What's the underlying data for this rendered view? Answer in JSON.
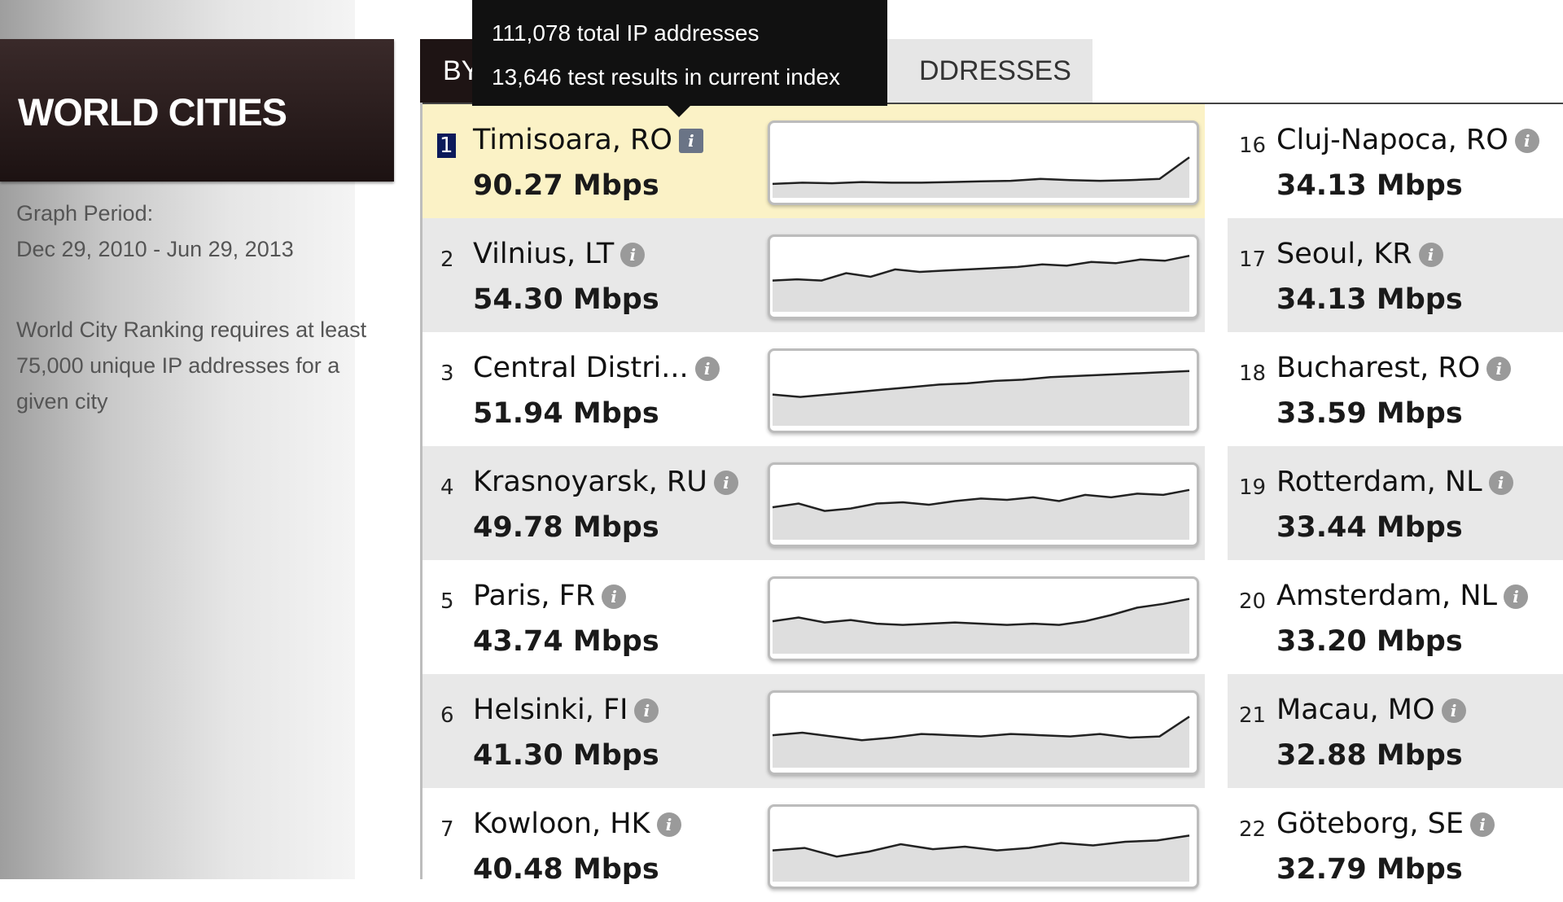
{
  "sidebar": {
    "title": "WORLD CITIES",
    "graph_period_label": "Graph Period:",
    "graph_period_range": "Dec 29, 2010 - Jun 29, 2013",
    "ranking_note": "World City Ranking requires at least 75,000 unique IP addresses for a given city"
  },
  "tabs": {
    "speed_label": "BY",
    "ip_label": "DDRESSES"
  },
  "tooltip": {
    "line1": "111,078 total IP addresses",
    "line2": "13,646 test results in current index"
  },
  "icons": {
    "info": "info-icon"
  },
  "colors": {
    "title_bg": "#1e1414",
    "selected_bg": "#fbf2c6",
    "highlight": "#0c1a5a"
  },
  "left_rankings": [
    {
      "rank": "1",
      "city": "Timisoara, RO",
      "speed": "90.27 Mbps",
      "trend": [
        0.12,
        0.14,
        0.13,
        0.15,
        0.14,
        0.14,
        0.15,
        0.16,
        0.17,
        0.2,
        0.18,
        0.17,
        0.18,
        0.2,
        0.55
      ]
    },
    {
      "rank": "2",
      "city": "Vilnius, LT",
      "speed": "54.30 Mbps",
      "trend": [
        0.4,
        0.42,
        0.4,
        0.52,
        0.46,
        0.58,
        0.54,
        0.56,
        0.58,
        0.6,
        0.62,
        0.66,
        0.64,
        0.7,
        0.68,
        0.74,
        0.72,
        0.8
      ]
    },
    {
      "rank": "3",
      "city": "Central Distri...",
      "speed": "51.94 Mbps",
      "trend": [
        0.4,
        0.36,
        0.4,
        0.44,
        0.48,
        0.52,
        0.56,
        0.58,
        0.62,
        0.64,
        0.68,
        0.7,
        0.72,
        0.74,
        0.76,
        0.78
      ]
    },
    {
      "rank": "4",
      "city": "Krasnoyarsk, RU",
      "speed": "49.78 Mbps",
      "trend": [
        0.42,
        0.48,
        0.36,
        0.4,
        0.48,
        0.5,
        0.46,
        0.52,
        0.56,
        0.54,
        0.58,
        0.52,
        0.62,
        0.58,
        0.64,
        0.62,
        0.7
      ]
    },
    {
      "rank": "5",
      "city": "Paris, FR",
      "speed": "43.74 Mbps",
      "trend": [
        0.42,
        0.48,
        0.4,
        0.44,
        0.38,
        0.36,
        0.38,
        0.4,
        0.38,
        0.36,
        0.38,
        0.36,
        0.42,
        0.52,
        0.64,
        0.7,
        0.78
      ]
    },
    {
      "rank": "6",
      "city": "Helsinki, FI",
      "speed": "41.30 Mbps",
      "trend": [
        0.42,
        0.46,
        0.4,
        0.34,
        0.38,
        0.44,
        0.42,
        0.4,
        0.44,
        0.42,
        0.4,
        0.44,
        0.38,
        0.4,
        0.72
      ]
    },
    {
      "rank": "7",
      "city": "Kowloon, HK",
      "speed": "40.48 Mbps",
      "trend": [
        0.4,
        0.44,
        0.3,
        0.38,
        0.5,
        0.42,
        0.46,
        0.4,
        0.44,
        0.52,
        0.48,
        0.54,
        0.56,
        0.64
      ]
    }
  ],
  "right_rankings": [
    {
      "rank": "16",
      "city": "Cluj-Napoca, RO",
      "speed": "34.13 Mbps"
    },
    {
      "rank": "17",
      "city": "Seoul, KR",
      "speed": "34.13 Mbps"
    },
    {
      "rank": "18",
      "city": "Bucharest, RO",
      "speed": "33.59 Mbps"
    },
    {
      "rank": "19",
      "city": "Rotterdam, NL",
      "speed": "33.44 Mbps"
    },
    {
      "rank": "20",
      "city": "Amsterdam, NL",
      "speed": "33.20 Mbps"
    },
    {
      "rank": "21",
      "city": "Macau, MO",
      "speed": "32.88 Mbps"
    },
    {
      "rank": "22",
      "city": "Göteborg, SE",
      "speed": "32.79 Mbps"
    }
  ]
}
